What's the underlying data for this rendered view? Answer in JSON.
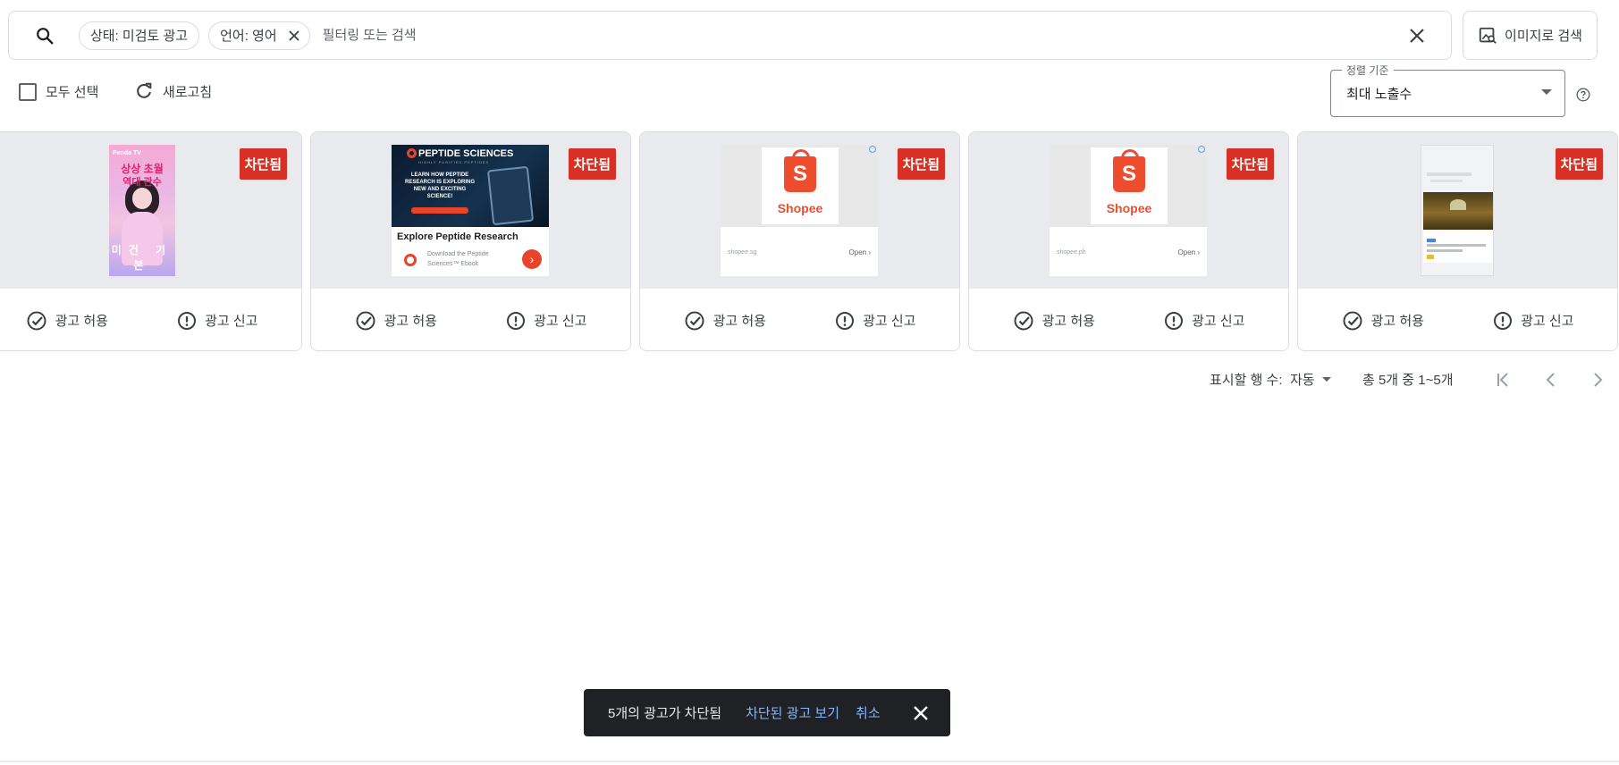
{
  "search": {
    "chips": [
      {
        "label": "상태: 미검토 광고",
        "closable": false
      },
      {
        "label": "언어: 영어",
        "closable": true
      }
    ],
    "placeholder": "필터링 또는 검색",
    "image_search_label": "이미지로 검색"
  },
  "toolbar": {
    "select_all_label": "모두 선택",
    "refresh_label": "새로고침",
    "sort_legend": "정렬 기준",
    "sort_value": "최대 노출수"
  },
  "cards": [
    {
      "badge": "차단됨",
      "allow_label": "광고 허용",
      "report_label": "광고 신고",
      "creative": {
        "top_text": "Panda TV",
        "headline": "상상 초월",
        "subline": "역대 관수",
        "bottom_text": "미건 기본"
      }
    },
    {
      "badge": "차단됨",
      "allow_label": "광고 허용",
      "report_label": "광고 신고",
      "creative": {
        "brand": "PEPTIDE SCIENCES",
        "tagline": "HIGHLY PURIFIED PEPTIDES",
        "copy": "LEARN HOW PEPTIDE RESEARCH IS EXPLORING NEW AND EXCITING SCIENCE!",
        "title": "Explore Peptide Research",
        "desc_line1": "Download the Peptide",
        "desc_line2": "Sciences™ Ebook",
        "cta_icon": "›"
      }
    },
    {
      "badge": "차단됨",
      "allow_label": "광고 허용",
      "report_label": "광고 신고",
      "creative": {
        "brand": "Shopee",
        "letter": "S",
        "domain": "shopee.sg",
        "open": "Open ›"
      }
    },
    {
      "badge": "차단됨",
      "allow_label": "광고 허용",
      "report_label": "광고 신고",
      "creative": {
        "brand": "Shopee",
        "letter": "S",
        "domain": "shopee.ph",
        "open": "Open ›"
      }
    },
    {
      "badge": "차단됨",
      "allow_label": "광고 허용",
      "report_label": "광고 신고",
      "creative": {}
    }
  ],
  "pager": {
    "rows_label": "표시할 행 수:",
    "rows_value": "자동",
    "range": "총 5개 중 1~5개"
  },
  "snackbar": {
    "message": "5개의 광고가 차단됨",
    "view_label": "차단된 광고 보기",
    "undo_label": "취소"
  },
  "colors": {
    "badge": "#d93025",
    "snackbar_bg": "#202124",
    "snackbar_link": "#8ab4f8",
    "shopee": "#ee4d2d",
    "peptide": "#e8442a"
  }
}
